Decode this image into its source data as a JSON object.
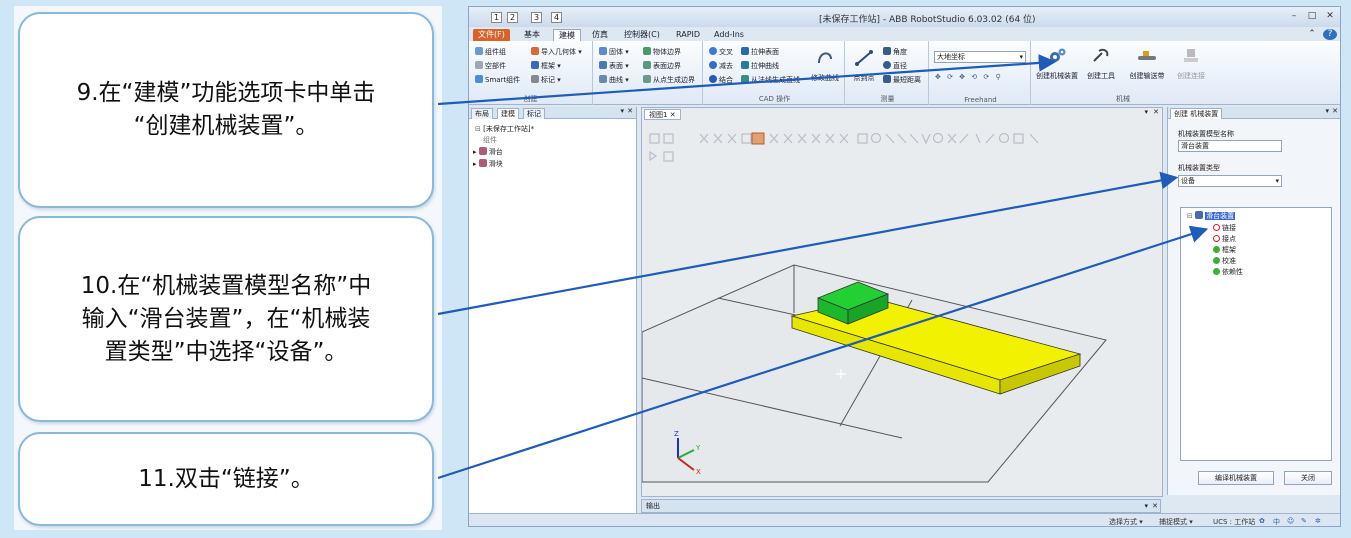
{
  "instructions": {
    "step9_line1": "9.在“建模”功能选项卡中单击",
    "step9_line2": "“创建机械装置”。",
    "step10_line1": "10.在“机械装置模型名称”中",
    "step10_line2": "输入“滑台装置”，在“机械装",
    "step10_line3": "置类型”中选择“设备”。",
    "step11_line1": "11.双击“链接”。"
  },
  "app": {
    "title": "[未保存工作站] - ABB RobotStudio 6.03.02 (64 位)",
    "quick_numbers": [
      "1",
      "2",
      "3",
      "4"
    ],
    "tabs": [
      "文件(F)",
      "基本",
      "建模",
      "仿真",
      "控制器(C)",
      "RAPID",
      "Add-Ins"
    ],
    "tab_keys": [
      "F",
      "H",
      "M",
      "S",
      "C",
      "R",
      "A"
    ]
  },
  "ribbon": {
    "group1": {
      "label": "创建",
      "items": [
        "组件组",
        "空部件",
        "Smart组件",
        "导入几何体",
        "框架",
        "标记"
      ]
    },
    "group2": {
      "items": [
        "固体",
        "表面",
        "曲线",
        "物体边界",
        "表面边界",
        "从点生成边界"
      ]
    },
    "group3": {
      "label": "CAD 操作",
      "items": [
        "交叉",
        "减去",
        "结合",
        "拉伸表面",
        "拉伸曲线",
        "从法线生成直线"
      ]
    },
    "modify_curve": "修改曲线",
    "measure": {
      "label": "测量",
      "items": [
        "点到点",
        "角度",
        "直径",
        "最短距离"
      ]
    },
    "freehand": {
      "label": "Freehand",
      "coord": "大地坐标"
    },
    "mechanism": {
      "label": "机械",
      "buttons": [
        "创建机械装置",
        "创建工具",
        "创建输送带",
        "创建连接"
      ]
    }
  },
  "browser": {
    "tabs": [
      "布局",
      "建模",
      "标记"
    ],
    "station": "[未保存工作站]*",
    "components": "组件",
    "items": [
      "滑台",
      "滑块"
    ]
  },
  "viewport": {
    "tab": "视图1"
  },
  "output": {
    "label": "输出"
  },
  "status": {
    "items": [
      "选择方式",
      "捕捉模式",
      "UCS : 工作站"
    ],
    "ime": "中"
  },
  "mech_panel": {
    "title": "创建 机械装置",
    "name_label": "机械装置模型名称",
    "name_value": "滑台装置",
    "type_label": "机械装置类型",
    "type_value": "设备",
    "tree_root": "滑台装置",
    "tree_items": [
      "链接",
      "接点",
      "框架",
      "校准",
      "依赖性"
    ],
    "compile_button": "编译机械装置",
    "close_button": "关闭"
  },
  "colors": {
    "callout_border": "#88b8da",
    "arrow": "#1f5bb8",
    "slide_yellow": "#f2f200",
    "slider_green": "#22d033",
    "file_tab": "#d9622a"
  }
}
